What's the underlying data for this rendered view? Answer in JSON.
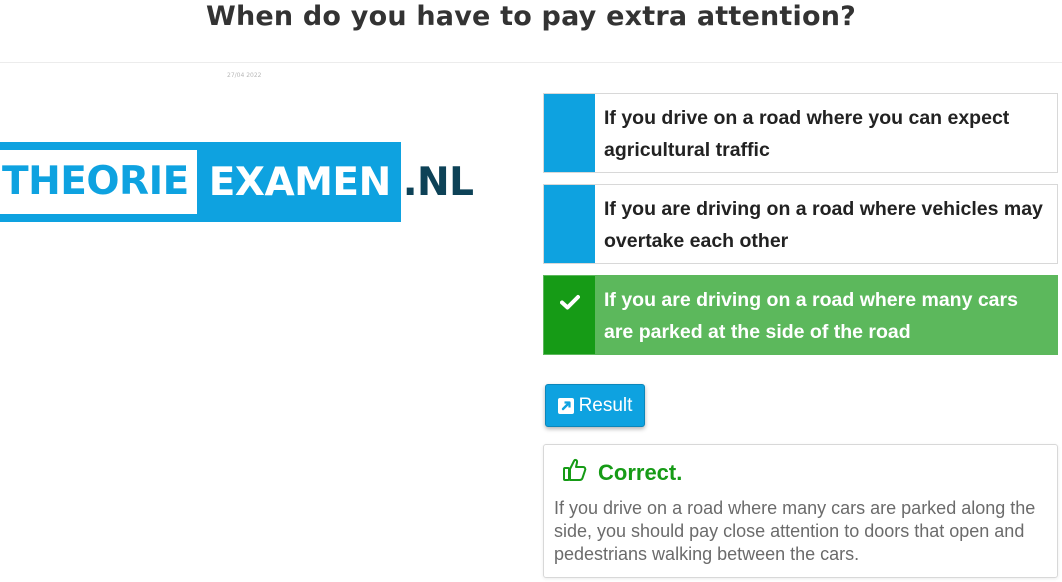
{
  "question": "When do you have to pay extra attention?",
  "tiny_note": "27/04 2022",
  "logo": {
    "part1": "THEORIE",
    "part2": "EXAMEN",
    "part3": ".NL"
  },
  "answers": [
    {
      "text": "If you drive on a road where you can expect agricultural traffic",
      "state": "neutral"
    },
    {
      "text": "If you are driving on a road where vehicles may overtake each other",
      "state": "neutral"
    },
    {
      "text": "If you are driving on a road where many cars are parked at the side of the road",
      "state": "correct",
      "icon": "check-icon"
    }
  ],
  "result_button": {
    "label": "Result",
    "icon": "external-link-icon"
  },
  "feedback": {
    "icon": "thumbs-up-icon",
    "title": "Correct.",
    "text": "If you drive on a road where many cars are parked along the side, you should pay close attention to doors that open and pedestrians walking between the cars."
  },
  "colors": {
    "blue": "#0ea2e0",
    "green": "#5cb85c",
    "dark_green": "#169b16",
    "navy": "#0d4257"
  }
}
